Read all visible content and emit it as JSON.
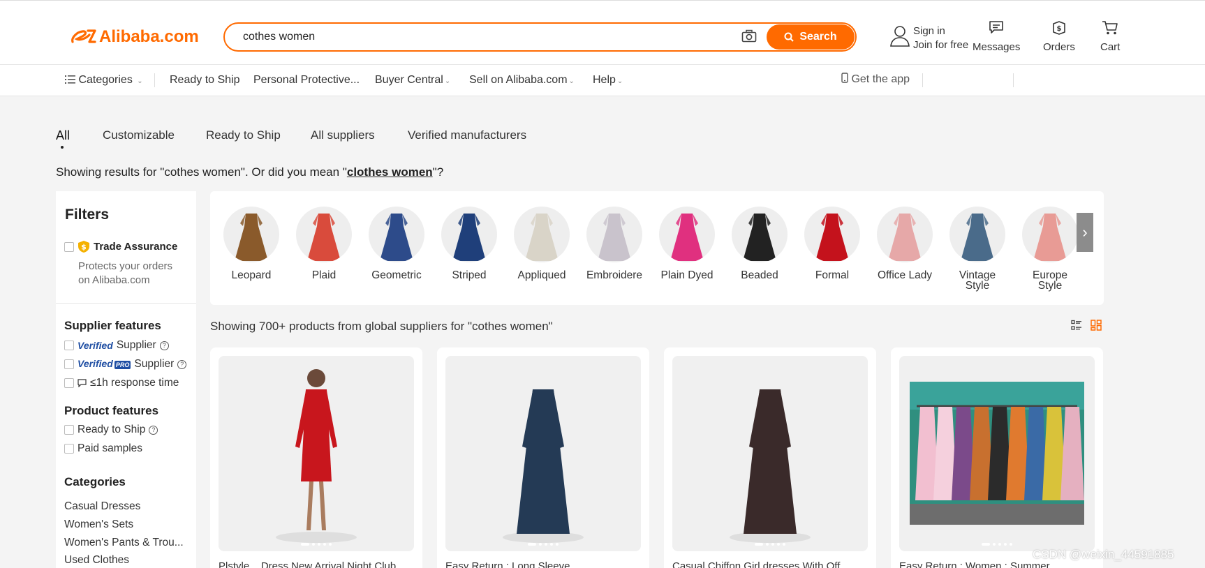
{
  "header": {
    "brand": "Alibaba.com",
    "search_value": "cothes women",
    "search_button": "Search",
    "sign_in": "Sign in",
    "join": "Join for free",
    "messages": "Messages",
    "orders": "Orders",
    "cart": "Cart"
  },
  "nav": {
    "categories": "Categories",
    "ready_to_ship": "Ready to Ship",
    "personal_protective": "Personal Protective...",
    "buyer_central": "Buyer Central",
    "sell": "Sell on Alibaba.com",
    "help": "Help",
    "get_app": "Get the app"
  },
  "tabs": [
    "All",
    "Customizable",
    "Ready to Ship",
    "All suppliers",
    "Verified manufacturers"
  ],
  "results": {
    "prefix": "Showing results for \"cothes women\". Or did you mean \"",
    "suggestion": "clothes women",
    "suffix": "\"?",
    "count_text": "Showing 700+ products from global suppliers for \"cothes women\""
  },
  "filters": {
    "title": "Filters",
    "trade_assurance": "Trade Assurance",
    "trade_assurance_desc_1": "Protects your orders",
    "trade_assurance_desc_2": "on Alibaba.com",
    "supplier_features": "Supplier features",
    "verified": "Verified",
    "supplier": "Supplier",
    "pro": "PRO",
    "response_time": "≤1h response time",
    "product_features": "Product features",
    "ready_to_ship": "Ready to Ship",
    "paid_samples": "Paid samples",
    "categories": "Categories",
    "category_items": [
      "Casual Dresses",
      "Women's Sets",
      "Women's Pants & Trou...",
      "Used Clothes"
    ]
  },
  "category_chips": [
    {
      "label": "Leopard",
      "color": "#8a5a2b"
    },
    {
      "label": "Plaid",
      "color": "#d94b3c"
    },
    {
      "label": "Geometric",
      "color": "#2d4b8a"
    },
    {
      "label": "Striped",
      "color": "#1f3f7a"
    },
    {
      "label": "Appliqued",
      "color": "#d9d4c8"
    },
    {
      "label": "Embroidere",
      "color": "#c9c3cc"
    },
    {
      "label": "Plain Dyed",
      "color": "#e0307f"
    },
    {
      "label": "Beaded",
      "color": "#222222"
    },
    {
      "label": "Formal",
      "color": "#c4121c"
    },
    {
      "label": "Office Lady",
      "color": "#e6a8a8"
    },
    {
      "label": "Vintage\nStyle",
      "label_1": "Vintage",
      "label_2": "Style",
      "color": "#4a6b8a"
    },
    {
      "label": "Europe\nStyle",
      "label_1": "Europe",
      "label_2": "Style",
      "color": "#e89b95"
    }
  ],
  "products": [
    {
      "title": "Plstyle... Dress New Arrival Night Club",
      "color": "#c8161d",
      "bg": "#f0f0f0"
    },
    {
      "title": "Easy Return : Long Sleeve",
      "color": "#243a55",
      "bg": "#f0f0f0"
    },
    {
      "title": "Casual Chiffon Girl dresses With Off",
      "color": "#3a2a2a",
      "bg": "#f0f0f0"
    },
    {
      "title": "Easy Return : Women : Summer",
      "color": "#e9a3b5",
      "bg": "#f0f0f0"
    }
  ],
  "watermark": "CSDN @weixin_44591885",
  "colors": {
    "accent": "#ff6a00",
    "verified": "#1f4ea3"
  }
}
